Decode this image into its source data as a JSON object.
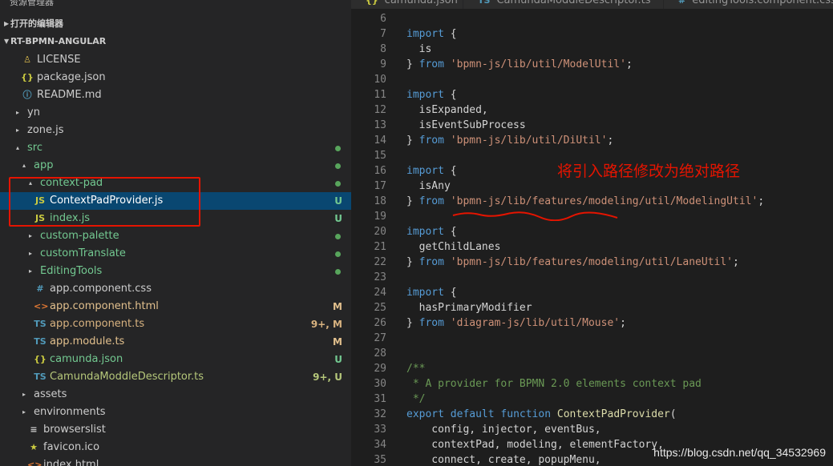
{
  "sidebar": {
    "title": "资源管理器",
    "open_editors_label": "打开的编辑器",
    "project_label": "RT-BPMN-ANGULAR",
    "items": [
      {
        "name": "LICENSE",
        "icon": "♙",
        "icon_name": "license-icon",
        "icon_color": "#d4b54c",
        "name_color": "#cccccc",
        "indent": 1,
        "caret": "",
        "badge": "",
        "dot": ""
      },
      {
        "name": "package.json",
        "icon": "{}",
        "icon_name": "json-icon",
        "icon_color": "#cbcb41",
        "name_color": "#cccccc",
        "indent": 1,
        "caret": "",
        "badge": "",
        "dot": ""
      },
      {
        "name": "README.md",
        "icon": "ⓘ",
        "icon_name": "info-icon",
        "icon_color": "#519aba",
        "name_color": "#cccccc",
        "indent": 1,
        "caret": "",
        "badge": "",
        "dot": ""
      },
      {
        "name": "yn",
        "icon": "",
        "icon_name": "",
        "icon_color": "",
        "name_color": "#cccccc",
        "indent": 1,
        "caret": "▸",
        "badge": "",
        "dot": ""
      },
      {
        "name": "zone.js",
        "icon": "",
        "icon_name": "",
        "icon_color": "",
        "name_color": "#cccccc",
        "indent": 1,
        "caret": "▸",
        "badge": "",
        "dot": ""
      },
      {
        "name": "src",
        "icon": "",
        "icon_name": "",
        "icon_color": "",
        "name_color": "#73c991",
        "indent": 1,
        "caret": "▴",
        "badge": "",
        "dot": "#58a55c"
      },
      {
        "name": "app",
        "icon": "",
        "icon_name": "",
        "icon_color": "",
        "name_color": "#73c991",
        "indent": 2,
        "caret": "▴",
        "badge": "",
        "dot": "#58a55c"
      },
      {
        "name": "context-pad",
        "icon": "",
        "icon_name": "",
        "icon_color": "",
        "name_color": "#73c991",
        "indent": 3,
        "caret": "▴",
        "badge": "",
        "dot": "#58a55c"
      },
      {
        "name": "ContextPadProvider.js",
        "icon": "JS",
        "icon_name": "javascript-file-icon",
        "icon_color": "#cbcb41",
        "name_color": "#ffffff",
        "indent": 3,
        "caret": "",
        "badge": "U",
        "badge_color": "#73c991",
        "dot": "",
        "selected": true
      },
      {
        "name": "index.js",
        "icon": "JS",
        "icon_name": "javascript-file-icon",
        "icon_color": "#cbcb41",
        "name_color": "#73c991",
        "indent": 3,
        "caret": "",
        "badge": "U",
        "badge_color": "#73c991",
        "dot": ""
      },
      {
        "name": "custom-palette",
        "icon": "",
        "icon_name": "",
        "icon_color": "",
        "name_color": "#73c991",
        "indent": 3,
        "caret": "▸",
        "badge": "",
        "dot": "#58a55c"
      },
      {
        "name": "customTranslate",
        "icon": "",
        "icon_name": "",
        "icon_color": "",
        "name_color": "#73c991",
        "indent": 3,
        "caret": "▸",
        "badge": "",
        "dot": "#58a55c"
      },
      {
        "name": "EditingTools",
        "icon": "",
        "icon_name": "",
        "icon_color": "",
        "name_color": "#73c991",
        "indent": 3,
        "caret": "▸",
        "badge": "",
        "dot": "#58a55c"
      },
      {
        "name": "app.component.css",
        "icon": "#",
        "icon_name": "css-file-icon",
        "icon_color": "#519aba",
        "name_color": "#cccccc",
        "indent": 3,
        "caret": "",
        "badge": "",
        "dot": ""
      },
      {
        "name": "app.component.html",
        "icon": "<>",
        "icon_name": "html-file-icon",
        "icon_color": "#e37933",
        "name_color": "#e2c08d",
        "indent": 3,
        "caret": "",
        "badge": "M",
        "badge_color": "#e2c08d",
        "dot": ""
      },
      {
        "name": "app.component.ts",
        "icon": "TS",
        "icon_name": "typescript-file-icon",
        "icon_color": "#519aba",
        "name_color": "#d9b380",
        "indent": 3,
        "caret": "",
        "badge": "9+, M",
        "badge_color": "#d9b380",
        "dot": ""
      },
      {
        "name": "app.module.ts",
        "icon": "TS",
        "icon_name": "typescript-file-icon",
        "icon_color": "#519aba",
        "name_color": "#e2c08d",
        "indent": 3,
        "caret": "",
        "badge": "M",
        "badge_color": "#e2c08d",
        "dot": ""
      },
      {
        "name": "camunda.json",
        "icon": "{}",
        "icon_name": "json-icon",
        "icon_color": "#cbcb41",
        "name_color": "#73c991",
        "indent": 3,
        "caret": "",
        "badge": "U",
        "badge_color": "#73c991",
        "dot": ""
      },
      {
        "name": "CamundaModdleDescriptor.ts",
        "icon": "TS",
        "icon_name": "typescript-file-icon",
        "icon_color": "#519aba",
        "name_color": "#b5c77a",
        "indent": 3,
        "caret": "",
        "badge": "9+, U",
        "badge_color": "#b5c77a",
        "dot": ""
      },
      {
        "name": "assets",
        "icon": "",
        "icon_name": "",
        "icon_color": "",
        "name_color": "#cccccc",
        "indent": 2,
        "caret": "▸",
        "badge": "",
        "dot": ""
      },
      {
        "name": "environments",
        "icon": "",
        "icon_name": "",
        "icon_color": "",
        "name_color": "#cccccc",
        "indent": 2,
        "caret": "▸",
        "badge": "",
        "dot": ""
      },
      {
        "name": "browserslist",
        "icon": "≡",
        "icon_name": "text-file-icon",
        "icon_color": "#cccccc",
        "name_color": "#cccccc",
        "indent": 2,
        "caret": "",
        "badge": "",
        "dot": ""
      },
      {
        "name": "favicon.ico",
        "icon": "★",
        "icon_name": "favicon-icon",
        "icon_color": "#cbcb41",
        "name_color": "#cccccc",
        "indent": 2,
        "caret": "",
        "badge": "",
        "dot": ""
      },
      {
        "name": "index.html",
        "icon": "<>",
        "icon_name": "html-file-icon",
        "icon_color": "#e37933",
        "name_color": "#cccccc",
        "indent": 2,
        "caret": "",
        "badge": "",
        "dot": ""
      }
    ]
  },
  "tabs": [
    {
      "icon": "{}",
      "icon_color": "#cbcb41",
      "label": "camunda.json"
    },
    {
      "icon": "TS",
      "icon_color": "#519aba",
      "label": "CamundaModdleDescriptor.ts"
    },
    {
      "icon": "#",
      "icon_color": "#519aba",
      "label": "editingTools.component.css"
    }
  ],
  "code_lines": [
    {
      "n": "6",
      "tokens": []
    },
    {
      "n": "7",
      "tokens": [
        {
          "t": "import",
          "c": "kw"
        },
        {
          "t": " {",
          "c": "pl"
        }
      ]
    },
    {
      "n": "8",
      "tokens": [
        {
          "t": "  is",
          "c": "pl"
        }
      ]
    },
    {
      "n": "9",
      "tokens": [
        {
          "t": "} ",
          "c": "pl"
        },
        {
          "t": "from",
          "c": "kw"
        },
        {
          "t": " ",
          "c": "pl"
        },
        {
          "t": "'bpmn-js/lib/util/ModelUtil'",
          "c": "str"
        },
        {
          "t": ";",
          "c": "pl"
        }
      ]
    },
    {
      "n": "10",
      "tokens": []
    },
    {
      "n": "11",
      "tokens": [
        {
          "t": "import",
          "c": "kw"
        },
        {
          "t": " {",
          "c": "pl"
        }
      ]
    },
    {
      "n": "12",
      "tokens": [
        {
          "t": "  isExpanded,",
          "c": "pl"
        }
      ]
    },
    {
      "n": "13",
      "tokens": [
        {
          "t": "  isEventSubProcess",
          "c": "pl"
        }
      ]
    },
    {
      "n": "14",
      "tokens": [
        {
          "t": "} ",
          "c": "pl"
        },
        {
          "t": "from",
          "c": "kw"
        },
        {
          "t": " ",
          "c": "pl"
        },
        {
          "t": "'bpmn-js/lib/util/DiUtil'",
          "c": "str"
        },
        {
          "t": ";",
          "c": "pl"
        }
      ]
    },
    {
      "n": "15",
      "tokens": []
    },
    {
      "n": "16",
      "tokens": [
        {
          "t": "import",
          "c": "kw"
        },
        {
          "t": " {",
          "c": "pl"
        }
      ]
    },
    {
      "n": "17",
      "tokens": [
        {
          "t": "  isAny",
          "c": "pl"
        }
      ]
    },
    {
      "n": "18",
      "tokens": [
        {
          "t": "} ",
          "c": "pl"
        },
        {
          "t": "from",
          "c": "kw"
        },
        {
          "t": " ",
          "c": "pl"
        },
        {
          "t": "'bpmn-js/lib/features/modeling/util/ModelingUtil'",
          "c": "str"
        },
        {
          "t": ";",
          "c": "pl"
        }
      ]
    },
    {
      "n": "19",
      "tokens": []
    },
    {
      "n": "20",
      "tokens": [
        {
          "t": "import",
          "c": "kw"
        },
        {
          "t": " {",
          "c": "pl"
        }
      ]
    },
    {
      "n": "21",
      "tokens": [
        {
          "t": "  getChildLanes",
          "c": "pl"
        }
      ]
    },
    {
      "n": "22",
      "tokens": [
        {
          "t": "} ",
          "c": "pl"
        },
        {
          "t": "from",
          "c": "kw"
        },
        {
          "t": " ",
          "c": "pl"
        },
        {
          "t": "'bpmn-js/lib/features/modeling/util/LaneUtil'",
          "c": "str"
        },
        {
          "t": ";",
          "c": "pl"
        }
      ]
    },
    {
      "n": "23",
      "tokens": []
    },
    {
      "n": "24",
      "tokens": [
        {
          "t": "import",
          "c": "kw"
        },
        {
          "t": " {",
          "c": "pl"
        }
      ]
    },
    {
      "n": "25",
      "tokens": [
        {
          "t": "  hasPrimaryModifier",
          "c": "pl"
        }
      ]
    },
    {
      "n": "26",
      "tokens": [
        {
          "t": "} ",
          "c": "pl"
        },
        {
          "t": "from",
          "c": "kw"
        },
        {
          "t": " ",
          "c": "pl"
        },
        {
          "t": "'diagram-js/lib/util/Mouse'",
          "c": "str"
        },
        {
          "t": ";",
          "c": "pl"
        }
      ]
    },
    {
      "n": "27",
      "tokens": []
    },
    {
      "n": "28",
      "tokens": []
    },
    {
      "n": "29",
      "tokens": [
        {
          "t": "/**",
          "c": "cm"
        }
      ]
    },
    {
      "n": "30",
      "tokens": [
        {
          "t": " * A provider for BPMN 2.0 elements context pad",
          "c": "cm"
        }
      ]
    },
    {
      "n": "31",
      "tokens": [
        {
          "t": " */",
          "c": "cm"
        }
      ]
    },
    {
      "n": "32",
      "tokens": [
        {
          "t": "export",
          "c": "kw"
        },
        {
          "t": " ",
          "c": "pl"
        },
        {
          "t": "default",
          "c": "kw"
        },
        {
          "t": " ",
          "c": "pl"
        },
        {
          "t": "function",
          "c": "kw"
        },
        {
          "t": " ",
          "c": "pl"
        },
        {
          "t": "ContextPadProvider",
          "c": "fn"
        },
        {
          "t": "(",
          "c": "pl"
        }
      ]
    },
    {
      "n": "33",
      "tokens": [
        {
          "t": "    config, injector, eventBus,",
          "c": "pl"
        }
      ]
    },
    {
      "n": "34",
      "tokens": [
        {
          "t": "    contextPad, modeling, elementFactory,",
          "c": "pl"
        }
      ]
    },
    {
      "n": "35",
      "tokens": [
        {
          "t": "    connect, create, popupMenu,",
          "c": "pl"
        }
      ]
    }
  ],
  "annotation": "将引入路径修改为绝对路径",
  "watermark": "https://blog.csdn.net/qq_34532969"
}
